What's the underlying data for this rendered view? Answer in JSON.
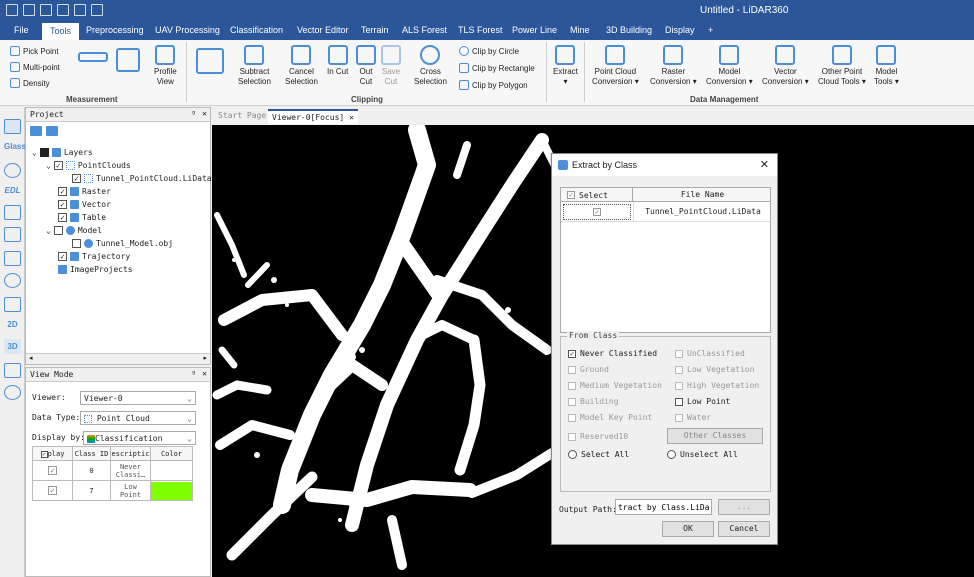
{
  "window": {
    "title": "Untitled - LiDAR360"
  },
  "menu": [
    "File",
    "Tools",
    "Preprocessing",
    "UAV Processing",
    "Classification",
    "Vector Editor",
    "Terrain",
    "ALS Forest",
    "TLS Forest",
    "Power Line",
    "Mine",
    "3D Building",
    "Display",
    "+"
  ],
  "ribbon": {
    "measurement": {
      "label": "Measurement",
      "pick_point": "Pick Point",
      "multi_point": "Multi-point",
      "density": "Density",
      "profile": "Profile",
      "profile2": "View"
    },
    "clipping": {
      "label": "Clipping",
      "subtract": "Subtract",
      "subtract2": "Selection",
      "cancel": "Cancel",
      "cancel2": "Selection",
      "in_cut": "In Cut",
      "out_cut": "Out",
      "out_cut2": "Cut",
      "save_cut": "Save",
      "save_cut2": "Cut",
      "cross": "Cross",
      "cross2": "Selection",
      "clip_circle": "Clip by Circle",
      "clip_rect": "Clip by Rectangle",
      "clip_poly": "Clip by Polygon"
    },
    "data_mgmt": {
      "label": "Data Management",
      "extract": "Extract",
      "pcc": "Point Cloud",
      "pcc2": "Conversion",
      "raster": "Raster",
      "raster2": "Conversion",
      "model": "Model",
      "model2": "Conversion",
      "vector": "Vector",
      "vector2": "Conversion",
      "other": "Other Point",
      "other2": "Cloud Tools",
      "model_tools": "Model",
      "model_tools2": "Tools"
    }
  },
  "left_tools": {
    "glass": "Glass",
    "edl": "EDL",
    "d2": "2D",
    "d3": "3D"
  },
  "project": {
    "title": "Project",
    "items": [
      "Layers",
      "PointClouds",
      "Tunnel_PointCloud.LiData",
      "Raster",
      "Vector",
      "Table",
      "Model",
      "Tunnel_Model.obj",
      "Trajectory",
      "ImageProjects"
    ]
  },
  "viewmode": {
    "title": "View Mode",
    "viewer_label": "Viewer:",
    "viewer_value": "Viewer-0",
    "datatype_label": "Data Type:",
    "datatype_value": "Point Cloud",
    "displayby_label": "Display by:",
    "displayby_value": "Classification",
    "headers": [
      "play",
      "Class ID",
      "escriptic",
      "Color"
    ],
    "rows": [
      {
        "id": "0",
        "desc1": "Never",
        "desc2": "Classi…",
        "color": "#ffffff"
      },
      {
        "id": "7",
        "desc1": "Low",
        "desc2": "Point",
        "color": "#80ff00"
      }
    ]
  },
  "tabs": {
    "start": "Start Page",
    "viewer": "Viewer-0[Focus]"
  },
  "dialog": {
    "title": "Extract by Class",
    "col_select": "Select",
    "col_file": "File Name",
    "file": "Tunnel_PointCloud.LiData",
    "from_class": "From Class",
    "classes": [
      "Never Classified",
      "UnClassified",
      "Ground",
      "Low Vegetation",
      "Medium Vegetation",
      "High Vegetation",
      "Building",
      "Low Point",
      "Model Key Point",
      "Water",
      "Reserved10"
    ],
    "other_classes": "Other Classes",
    "select_all": "Select All",
    "unselect_all": "Unselect All",
    "output_label": "Output Path:",
    "output_value": "tract by Class.LiData",
    "browse": "...",
    "ok": "OK",
    "cancel": "Cancel"
  }
}
